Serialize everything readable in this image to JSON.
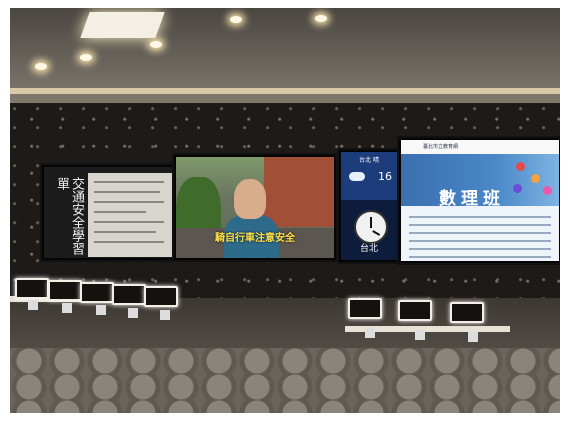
{
  "screens": {
    "left_title": "交通安全學習單",
    "video_subtitle": "騎自行車注意安全",
    "weather_header": "台北 晴",
    "weather_temp": "16",
    "city": "台北",
    "site_brand": "臺北市立教育網",
    "site_banner": "數理班"
  },
  "colors": {
    "wall": "#1d1a18",
    "screen_glow": "#f3efe6"
  }
}
